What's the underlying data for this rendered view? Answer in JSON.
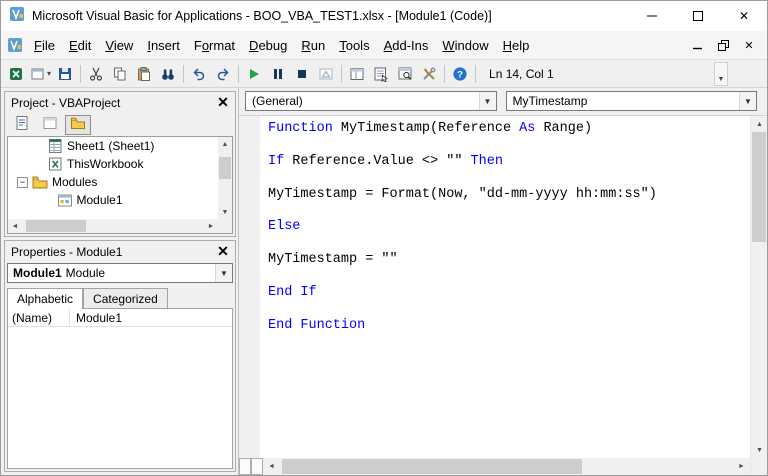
{
  "window": {
    "title": "Microsoft Visual Basic for Applications - BOO_VBA_TEST1.xlsx - [Module1 (Code)]"
  },
  "menubar": {
    "items": [
      {
        "label": "File",
        "u": 0
      },
      {
        "label": "Edit",
        "u": 0
      },
      {
        "label": "View",
        "u": 0
      },
      {
        "label": "Insert",
        "u": 0
      },
      {
        "label": "Format",
        "u": 1
      },
      {
        "label": "Debug",
        "u": 0
      },
      {
        "label": "Run",
        "u": 0
      },
      {
        "label": "Tools",
        "u": 0
      },
      {
        "label": "Add-Ins",
        "u": 0
      },
      {
        "label": "Window",
        "u": 0
      },
      {
        "label": "Help",
        "u": 0
      }
    ]
  },
  "toolbar": {
    "position_status": "Ln 14, Col 1",
    "groups": [
      [
        "view-microsoft-excel",
        "insert-object",
        "save"
      ],
      [
        "cut",
        "copy",
        "paste",
        "find"
      ],
      [
        "undo",
        "redo"
      ],
      [
        "run-macro",
        "break",
        "reset",
        "design-mode"
      ],
      [
        "project-explorer",
        "properties-window",
        "object-browser",
        "toolbox"
      ],
      [
        "help"
      ]
    ]
  },
  "project_panel": {
    "title": "Project - VBAProject",
    "tree_items": [
      {
        "label": "Sheet1 (Sheet1)",
        "icon": "sheet-icon",
        "depth": 2
      },
      {
        "label": "ThisWorkbook",
        "icon": "workbook-icon",
        "depth": 2
      },
      {
        "label": "Modules",
        "icon": "folder-icon",
        "depth": 1,
        "expanded": true
      },
      {
        "label": "Module1",
        "icon": "module-icon",
        "depth": 2.5
      }
    ]
  },
  "properties_panel": {
    "title": "Properties - Module1",
    "object_selector": {
      "name": "Module1",
      "type": "Module"
    },
    "tabs": [
      {
        "label": "Alphabetic",
        "active": true
      },
      {
        "label": "Categorized",
        "active": false
      }
    ],
    "rows": [
      {
        "property": "(Name)",
        "value": "Module1"
      }
    ]
  },
  "code_window": {
    "object_dropdown": "(General)",
    "procedure_dropdown": "MyTimestamp",
    "code_lines": [
      {
        "segments": [
          {
            "type": "keyword",
            "text": "Function"
          },
          {
            "type": "plain",
            "text": " MyTimestamp(Reference "
          },
          {
            "type": "keyword",
            "text": "As"
          },
          {
            "type": "plain",
            "text": " Range)"
          }
        ]
      },
      {
        "segments": []
      },
      {
        "segments": [
          {
            "type": "keyword",
            "text": "If"
          },
          {
            "type": "plain",
            "text": " Reference.Value <> \"\" "
          },
          {
            "type": "keyword",
            "text": "Then"
          }
        ]
      },
      {
        "segments": []
      },
      {
        "segments": [
          {
            "type": "plain",
            "text": "MyTimestamp = Format(Now, \"dd-mm-yyyy hh:mm:ss\")"
          }
        ]
      },
      {
        "segments": []
      },
      {
        "segments": [
          {
            "type": "keyword",
            "text": "Else"
          }
        ]
      },
      {
        "segments": []
      },
      {
        "segments": [
          {
            "type": "plain",
            "text": "MyTimestamp = \"\""
          }
        ]
      },
      {
        "segments": []
      },
      {
        "segments": [
          {
            "type": "keyword",
            "text": "End If"
          }
        ]
      },
      {
        "segments": []
      },
      {
        "segments": [
          {
            "type": "keyword",
            "text": "End Function"
          }
        ]
      }
    ]
  },
  "colors": {
    "keyword": "#0000ff",
    "run_green": "#2e9e44",
    "help_blue": "#2573cf",
    "folder_yellow": "#f6c84c"
  }
}
